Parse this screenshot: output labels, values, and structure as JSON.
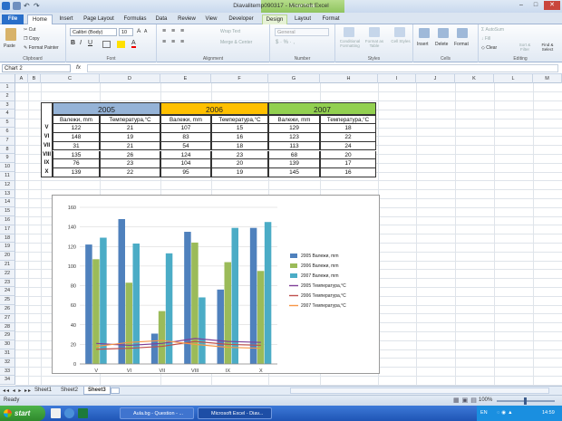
{
  "window": {
    "title": "Diavalitemp090317 - Microsoft Excel",
    "chart_tools": "Chart Tools"
  },
  "tabs": [
    "File",
    "Home",
    "Insert",
    "Page Layout",
    "Formulas",
    "Data",
    "Review",
    "View",
    "Developer",
    "Design",
    "Layout",
    "Format"
  ],
  "ribbon": {
    "clipboard": {
      "paste": "Paste",
      "cut": "Cut",
      "copy": "Copy",
      "format_painter": "Format Painter",
      "label": "Clipboard"
    },
    "font": {
      "name": "Calibri (Body)",
      "size": "10",
      "label": "Font"
    },
    "alignment": {
      "wrap": "Wrap Text",
      "merge": "Merge & Center",
      "label": "Alignment"
    },
    "number": {
      "format": "General",
      "label": "Number"
    },
    "styles": {
      "cond": "Conditional Formatting",
      "table": "Format as Table",
      "cell": "Cell Styles",
      "label": "Styles"
    },
    "cells": {
      "insert": "Insert",
      "delete": "Delete",
      "format": "Format",
      "label": "Cells"
    },
    "editing": {
      "autosum": "AutoSum",
      "fill": "Fill",
      "clear": "Clear",
      "sort": "Sort & Filter",
      "find": "Find & Select",
      "label": "Editing"
    }
  },
  "namebox": "Chart 2",
  "columns": [
    "A",
    "B",
    "C",
    "D",
    "E",
    "F",
    "G",
    "H",
    "I",
    "J",
    "K",
    "L",
    "M",
    "N"
  ],
  "rows": [
    "1",
    "2",
    "3",
    "4",
    "5",
    "6",
    "7",
    "8",
    "9",
    "10",
    "11",
    "12",
    "13",
    "14",
    "15",
    "16",
    "17",
    "18",
    "19",
    "20",
    "21",
    "22",
    "23",
    "24",
    "25",
    "26",
    "27",
    "28",
    "29",
    "30",
    "31",
    "32",
    "33",
    "34"
  ],
  "table": {
    "years": [
      "2005",
      "2006",
      "2007"
    ],
    "year_colors": [
      "#95b3d7",
      "#ffc000",
      "#92d050"
    ],
    "subheaders": [
      "Валежи, mm",
      "Температура,°C"
    ],
    "row_labels": [
      "V",
      "VI",
      "VII",
      "VIII",
      "IX",
      "X"
    ],
    "rows": [
      [
        "122",
        "21",
        "107",
        "15",
        "129",
        "18"
      ],
      [
        "148",
        "19",
        "83",
        "16",
        "123",
        "22"
      ],
      [
        "31",
        "21",
        "54",
        "18",
        "113",
        "24"
      ],
      [
        "135",
        "26",
        "124",
        "23",
        "68",
        "20"
      ],
      [
        "76",
        "23",
        "104",
        "20",
        "139",
        "17"
      ],
      [
        "139",
        "22",
        "95",
        "19",
        "145",
        "16"
      ]
    ]
  },
  "chart_data": {
    "type": "bar",
    "categories": [
      "V",
      "VI",
      "VII",
      "VIII",
      "IX",
      "X"
    ],
    "ylim": [
      0,
      160
    ],
    "yticks": [
      "0",
      "20",
      "40",
      "60",
      "80",
      "100",
      "120",
      "140",
      "160"
    ],
    "grid": true,
    "legend_position": "right",
    "series": [
      {
        "name": "2005 Валежи, mm",
        "kind": "bar",
        "color": "#4f81bd",
        "values": [
          122,
          148,
          31,
          135,
          76,
          139
        ]
      },
      {
        "name": "2006 Валежи, mm",
        "kind": "bar",
        "color": "#9bbb59",
        "values": [
          107,
          83,
          54,
          124,
          104,
          95
        ]
      },
      {
        "name": "2007 Валежи, mm",
        "kind": "bar",
        "color": "#4bacc6",
        "values": [
          129,
          123,
          113,
          68,
          139,
          145
        ]
      },
      {
        "name": "2005 Температура,°C",
        "kind": "line",
        "color": "#7f3f98",
        "values": [
          21,
          19,
          21,
          26,
          23,
          22
        ]
      },
      {
        "name": "2006 Температура,°C",
        "kind": "line",
        "color": "#c0504d",
        "values": [
          15,
          16,
          18,
          23,
          20,
          19
        ]
      },
      {
        "name": "2007 Температура,°C",
        "kind": "line",
        "color": "#f79646",
        "values": [
          18,
          22,
          24,
          20,
          17,
          16
        ]
      }
    ]
  },
  "sheets": [
    "Sheet1",
    "Sheet2",
    "Sheet3"
  ],
  "status": {
    "ready": "Ready",
    "zoom": "100%"
  },
  "taskbar": {
    "start": "start",
    "tasks": [
      "Aula.bg - Question - ...",
      "Microsoft Excel - Diav..."
    ],
    "lang": "EN",
    "time": "14:59"
  }
}
